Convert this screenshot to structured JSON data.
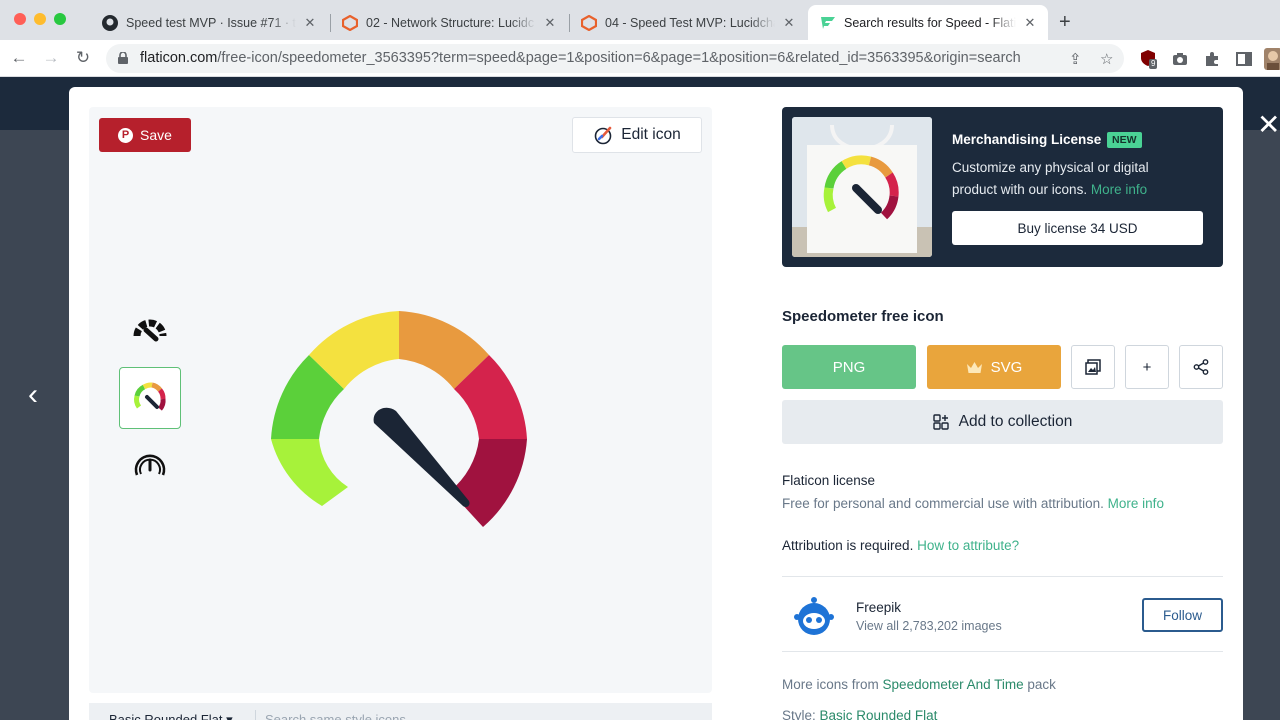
{
  "browser": {
    "tabs": [
      {
        "title": "Speed test MVP · Issue #71 · th",
        "close": "✕"
      },
      {
        "title": "02 - Network Structure: Lucidc",
        "close": "✕"
      },
      {
        "title": "04 - Speed Test MVP: Lucidcha",
        "close": "✕"
      },
      {
        "title": "Search results for Speed - Flati",
        "close": "✕"
      }
    ],
    "new_tab": "+",
    "url_host": "flaticon.com",
    "url_path": "/free-icon/speedometer_3563395?term=speed&page=1&position=6&page=1&position=6&related_id=3563395&origin=search",
    "ext_badge": "9"
  },
  "preview": {
    "save_label": "Save",
    "pin_glyph": "P",
    "edit_label": "Edit icon",
    "style_name": "Basic Rounded Flat",
    "style_chevron": "▾",
    "style_search_placeholder": "Search same style icons"
  },
  "merch": {
    "title": "Merchandising License",
    "badge": "NEW",
    "desc": "Customize any physical or digital product with our icons.",
    "more": "More info",
    "buy": "Buy license 34 USD"
  },
  "details": {
    "icon_title": "Speedometer free icon",
    "png_label": "PNG",
    "svg_label": "SVG",
    "plus_label": "+",
    "collection_label": "Add to collection",
    "license_title": "Flaticon license",
    "license_desc": "Free for personal and commercial use with attribution.",
    "license_more": "More info",
    "attribution": "Attribution is required.",
    "attribution_link": "How to attribute?",
    "author_name": "Freepik",
    "author_count": "View all 2,783,202 images",
    "follow_label": "Follow",
    "more_icons_prefix": "More icons from",
    "more_icons_pack": "Speedometer And Time",
    "more_icons_suffix": "pack",
    "style_prefix": "Style:",
    "style_value": "Basic Rounded Flat"
  },
  "nav": {
    "close": "✕",
    "prev": "‹"
  },
  "colors": {
    "png": "#66c587",
    "svg": "#e9a53c",
    "brand_red": "#b6202c",
    "dark": "#1c2a3c",
    "accent": "#3fb28b"
  }
}
